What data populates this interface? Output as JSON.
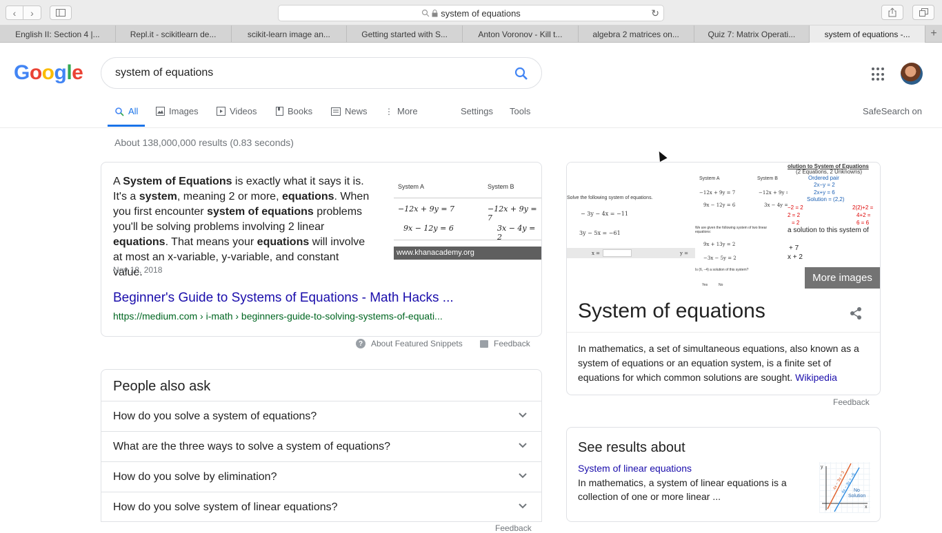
{
  "browser": {
    "address": "system of equations",
    "tabs": [
      {
        "label": "English II: Section 4 |..."
      },
      {
        "label": "Repl.it - scikitlearn de..."
      },
      {
        "label": "scikit-learn image an..."
      },
      {
        "label": "Getting started with S..."
      },
      {
        "label": "Anton Voronov - Kill t..."
      },
      {
        "label": "algebra 2 matrices on..."
      },
      {
        "label": "Quiz 7: Matrix Operati..."
      },
      {
        "label": "system of equations -..."
      }
    ],
    "add_tab": "+"
  },
  "google": {
    "logo_letters": [
      "G",
      "o",
      "o",
      "g",
      "l",
      "e"
    ],
    "logo_colors": [
      "#4285F4",
      "#EA4335",
      "#FBBC05",
      "#4285F4",
      "#34A853",
      "#EA4335"
    ],
    "query": "system of equations",
    "nav": {
      "all": "All",
      "images": "Images",
      "videos": "Videos",
      "books": "Books",
      "news": "News",
      "more": "More",
      "settings": "Settings",
      "tools": "Tools",
      "safesearch": "SafeSearch on"
    },
    "stats": "About 138,000,000 results (0.83 seconds)"
  },
  "snippet": {
    "date": "Nov 18, 2018",
    "link_title": "Beginner's Guide to Systems of Equations - Math Hacks ...",
    "url": "https://medium.com › i-math › beginners-guide-to-solving-systems-of-equati...",
    "image_source": "www.khanacademy.org",
    "image": {
      "header_a": "System A",
      "header_b": "System B",
      "a1": "−12x + 9y = 7",
      "a2": "9x − 12y = 6",
      "b1": "−12x + 9y = 7",
      "b2": "3x − 4y = 2"
    },
    "about": "About Featured Snippets",
    "feedback": "Feedback"
  },
  "paa": {
    "title": "People also ask",
    "questions": [
      "How do you solve a system of equations?",
      "What are the three ways to solve a system of equations?",
      "How do you solve by elimination?",
      "How do you solve system of linear equations?"
    ],
    "feedback": "Feedback"
  },
  "knowledge": {
    "images": {
      "img1": {
        "heading": "Solve the following system of equations.",
        "eq1": "− 3y − 4x = −11",
        "eq2": "3y − 5x = −61",
        "x_label": "x =",
        "y_label": "y ="
      },
      "img2": {
        "sys_a": "System A",
        "sys_b": "System B",
        "a1": "−12x + 9y = 7",
        "a2": "9x − 12y = 6",
        "b1": "−12x + 9y = 7",
        "b2": "3x − 4y = 2",
        "prompt": "We are given the following system of two linear equations:",
        "eq1": "9x + 13y = 2",
        "eq2": "−3x − 5y = 2",
        "question": "Is (6, −4) a solution of this system?",
        "yes": "Yes",
        "no": "No"
      },
      "img3": {
        "title": "olution to System of Equations",
        "subtitle": "(2 Equations, 2 Unknowns)",
        "ordered": "Ordered pair",
        "e1": "2x−y = 2",
        "e2": "2x+y = 6",
        "sol": "Solution = (2,2)",
        "l1": "−2 = 2",
        "l2": "2 = 2",
        "l3": "= 2",
        "r1": "2(2)+2 =",
        "r2": "4+2 =",
        "r3": "6 = 6",
        "caption": "a solution to this system of",
        "p1": "+ 7",
        "p2": "x + 2"
      }
    },
    "more_images": "More images",
    "title": "System of equations",
    "description": "In mathematics, a set of simultaneous equations, also known as a system of equations or an equation system, is a finite set of equations for which common solutions are sought.",
    "source": "Wikipedia",
    "feedback": "Feedback"
  },
  "see_results": {
    "title": "See results about",
    "link": "System of linear equations",
    "description": "In mathematics, a system of linear equations is a collection of one or more linear ...",
    "thumb": {
      "y": "y",
      "x": "x",
      "l1": "4x − 3y = 3",
      "l2": "4x − 3y = −6",
      "no": "No",
      "solution": "Solution"
    }
  }
}
